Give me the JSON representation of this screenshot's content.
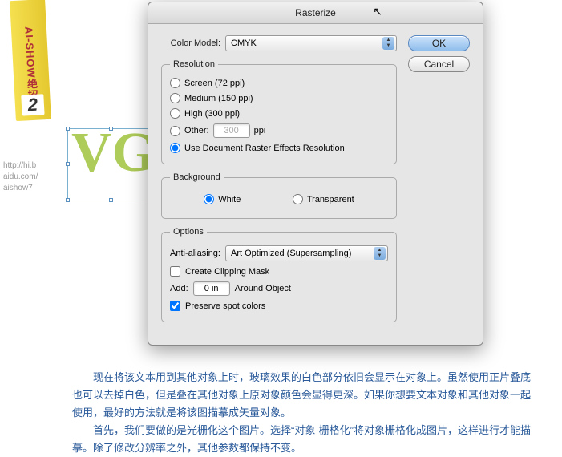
{
  "sidebar": {
    "tag_text": "AI-SHOW绝招",
    "number": "2"
  },
  "url_text": "http://hi.b\naidu.com/\naishow7",
  "artwork_text": "VG",
  "dialog": {
    "title": "Rasterize",
    "color_model_label": "Color Model:",
    "color_model_value": "CMYK",
    "ok": "OK",
    "cancel": "Cancel",
    "resolution": {
      "legend": "Resolution",
      "screen": "Screen (72 ppi)",
      "medium": "Medium (150 ppi)",
      "high": "High (300 ppi)",
      "other": "Other:",
      "other_value": "300",
      "ppi": "ppi",
      "document": "Use Document Raster Effects Resolution"
    },
    "background": {
      "legend": "Background",
      "white": "White",
      "transparent": "Transparent"
    },
    "options": {
      "legend": "Options",
      "anti_label": "Anti-aliasing:",
      "anti_value": "Art Optimized (Supersampling)",
      "clip": "Create Clipping Mask",
      "add": "Add:",
      "add_value": "0 in",
      "around": "Around Object",
      "preserve": "Preserve spot colors"
    }
  },
  "para1": "现在将该文本用到其他对象上时，玻璃效果的白色部分依旧会显示在对象上。虽然使用正片叠底也可以去掉白色，但是叠在其他对象上原对象颜色会显得更深。如果你想要文本对象和其他对象一起使用，最好的方法就是将该图描摹成矢量对象。",
  "para2": "首先，我们要做的是光栅化这个图片。选择“对象-栅格化”将对象栅格化成图片，这样进行才能描摹。除了修改分辨率之外，其他参数都保持不变。"
}
